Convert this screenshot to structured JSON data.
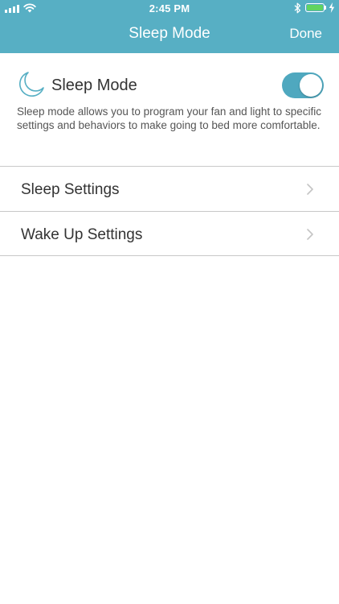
{
  "status_bar": {
    "time": "2:45 PM",
    "battery_level": 1.0,
    "battery_color": "#61d45f"
  },
  "nav": {
    "title": "Sleep Mode",
    "done_label": "Done",
    "background_color": "#57afc4"
  },
  "sleep_mode": {
    "icon": "moon-icon",
    "label": "Sleep Mode",
    "enabled": true,
    "toggle_color": "#4fa8bf",
    "description": "Sleep mode allows you to program your fan and light to specific settings and behaviors to make going to bed more comfortable."
  },
  "settings_list": {
    "items": [
      {
        "label": "Sleep Settings",
        "icon": "chevron-right-icon"
      },
      {
        "label": "Wake Up Settings",
        "icon": "chevron-right-icon"
      }
    ]
  }
}
